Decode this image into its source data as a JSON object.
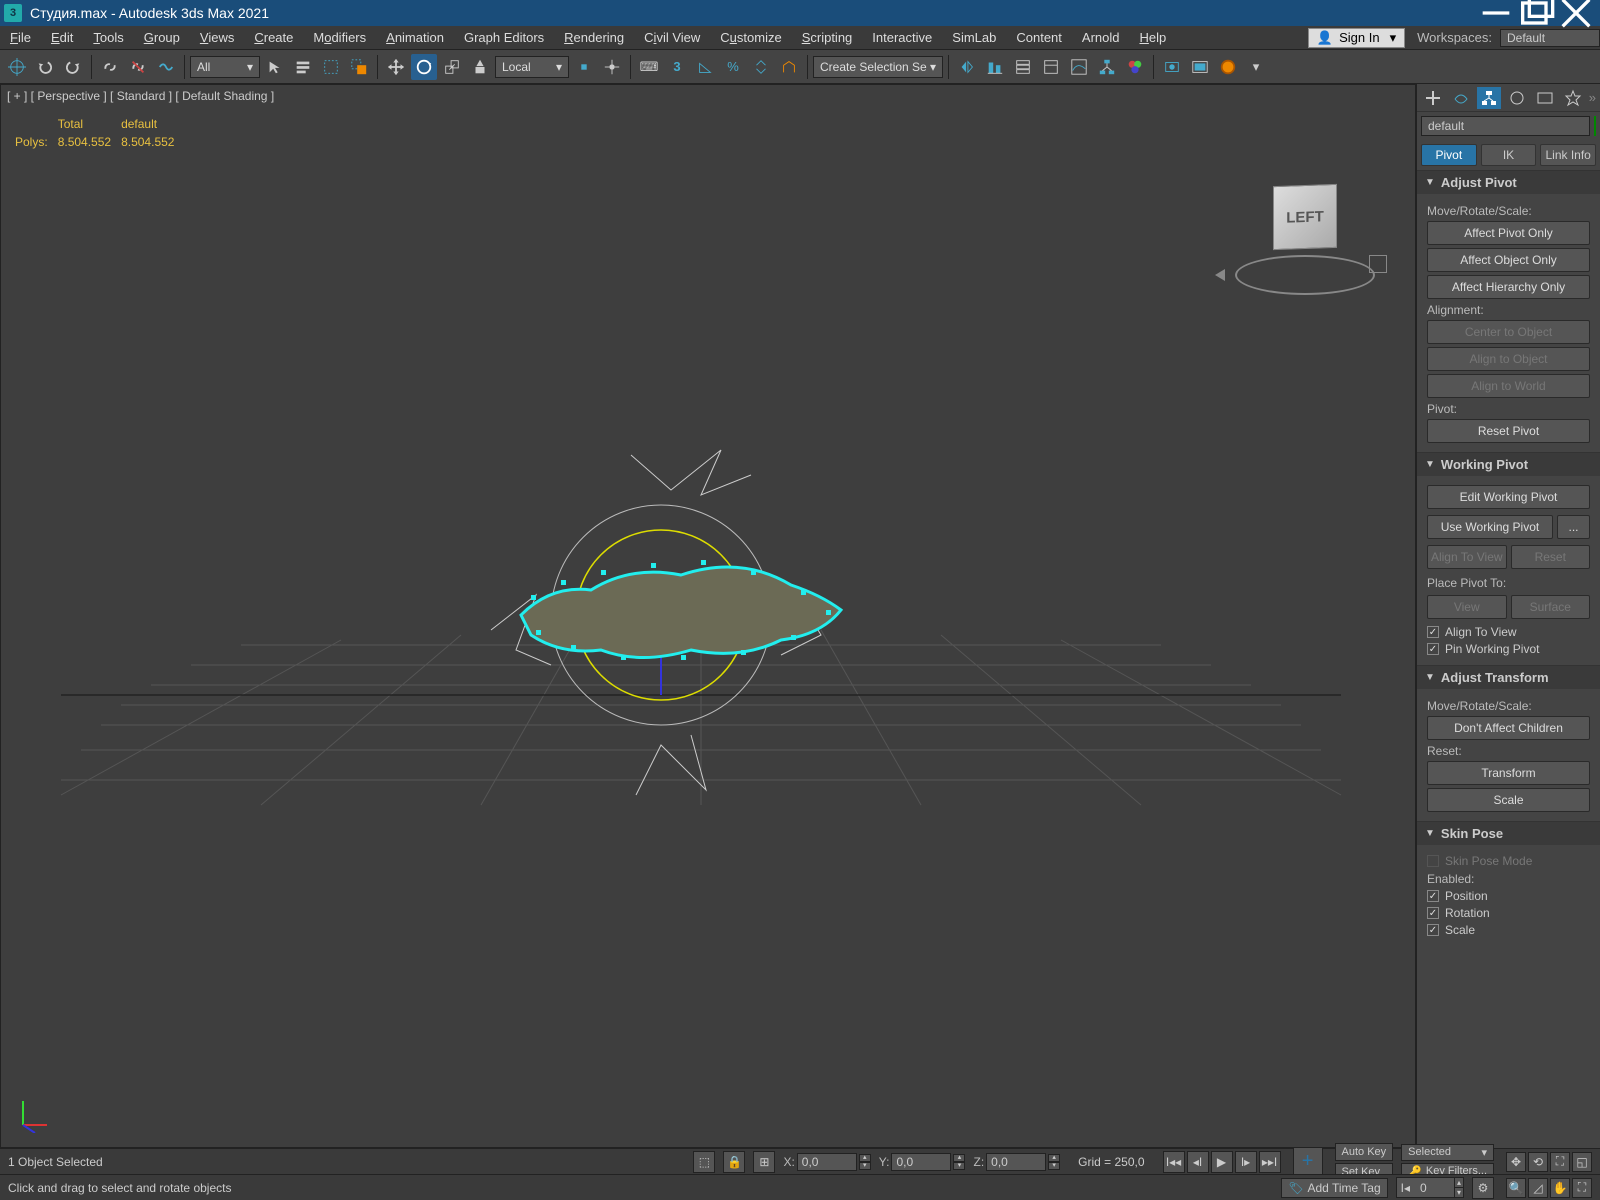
{
  "title": "Студия.max - Autodesk 3ds Max 2021",
  "menu": [
    "File",
    "Edit",
    "Tools",
    "Group",
    "Views",
    "Create",
    "Modifiers",
    "Animation",
    "Graph Editors",
    "Rendering",
    "Civil View",
    "Customize",
    "Scripting",
    "Interactive",
    "SimLab",
    "Content",
    "Arnold",
    "Help"
  ],
  "signin": "Sign In",
  "workspaces_label": "Workspaces:",
  "workspace": "Default",
  "toolbar": {
    "set_dropdown": "All",
    "ref_dropdown": "Local",
    "create_sel": "Create Selection Se"
  },
  "viewport": {
    "label": "[ + ] [ Perspective ] [ Standard ] [ Default Shading ]",
    "cube_face": "LEFT",
    "stats_h1": "Total",
    "stats_h2": "default",
    "stats_r1": "Polys:",
    "stats_v1": "8.504.552",
    "stats_v2": "8.504.552"
  },
  "command": {
    "search": "default",
    "tabs": {
      "pivot": "Pivot",
      "ik": "IK",
      "link": "Link Info"
    },
    "roll_adjust_pivot": "Adjust Pivot",
    "mrs": "Move/Rotate/Scale:",
    "affect_pivot": "Affect Pivot Only",
    "affect_object": "Affect Object Only",
    "affect_hierarchy": "Affect Hierarchy Only",
    "alignment": "Alignment:",
    "center_obj": "Center to Object",
    "align_obj": "Align to Object",
    "align_world": "Align to World",
    "pivot_lbl": "Pivot:",
    "reset_pivot": "Reset Pivot",
    "roll_working": "Working Pivot",
    "edit_wp": "Edit Working Pivot",
    "use_wp": "Use Working Pivot",
    "dots": "...",
    "align_view_btn": "Align To View",
    "reset_btn": "Reset",
    "place_pivot": "Place Pivot To:",
    "view_btn": "View",
    "surface_btn": "Surface",
    "align_view_chk": "Align To View",
    "pin_wp": "Pin Working Pivot",
    "roll_adjust_trans": "Adjust Transform",
    "dont_affect": "Don't Affect Children",
    "reset_lbl": "Reset:",
    "transform_btn": "Transform",
    "scale_btn": "Scale",
    "roll_skin": "Skin Pose",
    "skin_pose_mode": "Skin Pose Mode",
    "enabled": "Enabled:",
    "pos": "Position",
    "rot": "Rotation",
    "scl": "Scale"
  },
  "timeline": {
    "selection": "1 Object Selected",
    "x": "X:",
    "xv": "0,0",
    "y": "Y:",
    "yv": "0,0",
    "z": "Z:",
    "zv": "0,0",
    "grid": "Grid = 250,0",
    "autokey": "Auto Key",
    "setkey": "Set Key",
    "selected": "Selected",
    "keyfilters": "Key Filters...",
    "frame": "0"
  },
  "status": {
    "hint": "Click and drag to select and rotate objects",
    "addtag": "Add Time Tag"
  }
}
